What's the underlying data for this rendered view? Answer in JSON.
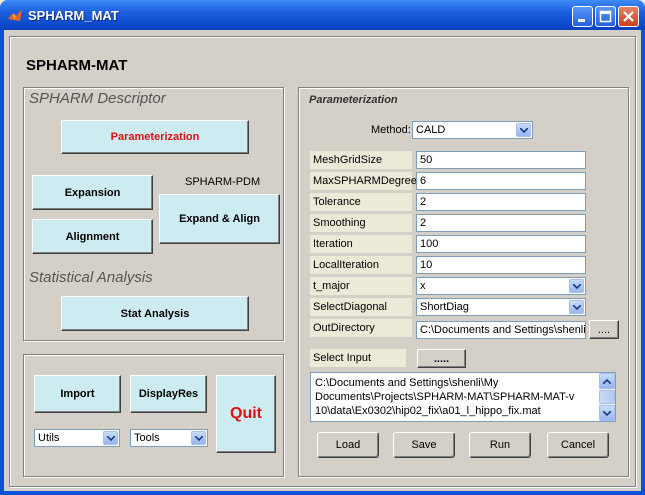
{
  "window": {
    "title": "SPHARM_MAT"
  },
  "app_title": "SPHARM-MAT",
  "descriptor": {
    "title": "SPHARM Descriptor",
    "parameterization": "Parameterization",
    "spharm_pdm": "SPHARM-PDM",
    "expansion": "Expansion",
    "expand_align": "Expand & Align",
    "alignment": "Alignment",
    "stat_title": "Statistical Analysis",
    "stat_analysis": "Stat Analysis"
  },
  "bottom": {
    "import": "Import",
    "displayres": "DisplayRes",
    "quit": "Quit",
    "utils": "Utils",
    "tools": "Tools"
  },
  "param": {
    "title": "Parameterization",
    "method_label": "Method:",
    "method_value": "CALD",
    "fields": [
      {
        "label": "MeshGridSize",
        "value": "50"
      },
      {
        "label": "MaxSPHARMDegree",
        "value": "6"
      },
      {
        "label": "Tolerance",
        "value": "2"
      },
      {
        "label": "Smoothing",
        "value": "2"
      },
      {
        "label": "Iteration",
        "value": "100"
      },
      {
        "label": "LocalIteration",
        "value": "10"
      }
    ],
    "t_major_label": "t_major",
    "t_major_value": "x",
    "select_diag_label": "SelectDiagonal",
    "select_diag_value": "ShortDiag",
    "outdir_label": "OutDirectory",
    "outdir_value": "C:\\Documents and Settings\\shenli\\My",
    "outdir_browse": "....",
    "select_input_label": "Select Input",
    "select_input_btn": ".....",
    "input_list": [
      "C:\\Documents and Settings\\shenli\\My",
      "Documents\\Projects\\SPHARM-MAT\\SPHARM-MAT-v",
      "10\\data\\Ex0302\\hip02_fix\\a01_l_hippo_fix.mat"
    ],
    "load": "Load",
    "save": "Save",
    "run": "Run",
    "cancel": "Cancel"
  }
}
